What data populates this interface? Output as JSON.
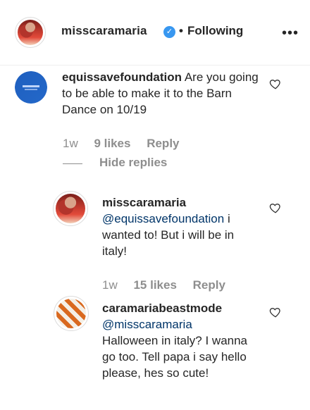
{
  "header": {
    "username": "misscaramaria",
    "verified_icon": "verified-badge-icon",
    "separator": "•",
    "follow_status": "Following",
    "more_icon": "more-options-icon"
  },
  "comments": [
    {
      "username": "equissavefoundation",
      "text": "Are you going to be able to make it to the Barn Dance on 10/19",
      "time": "1w",
      "likes": "9 likes",
      "reply": "Reply",
      "hide_replies": "Hide replies"
    },
    {
      "username": "misscaramaria",
      "mention": "@equissavefoundation",
      "text": "i wanted to! But i will be in italy!",
      "time": "1w",
      "likes": "15 likes",
      "reply": "Reply"
    },
    {
      "username": "caramariabeastmode",
      "mention": "@misscaramaria",
      "text": "Halloween in italy? I wanna go too. Tell papa i say hello please, hes so cute!"
    }
  ],
  "colors": {
    "text": "#262626",
    "muted": "#8e8e8e",
    "verified": "#3897f0",
    "mention": "#003569"
  }
}
